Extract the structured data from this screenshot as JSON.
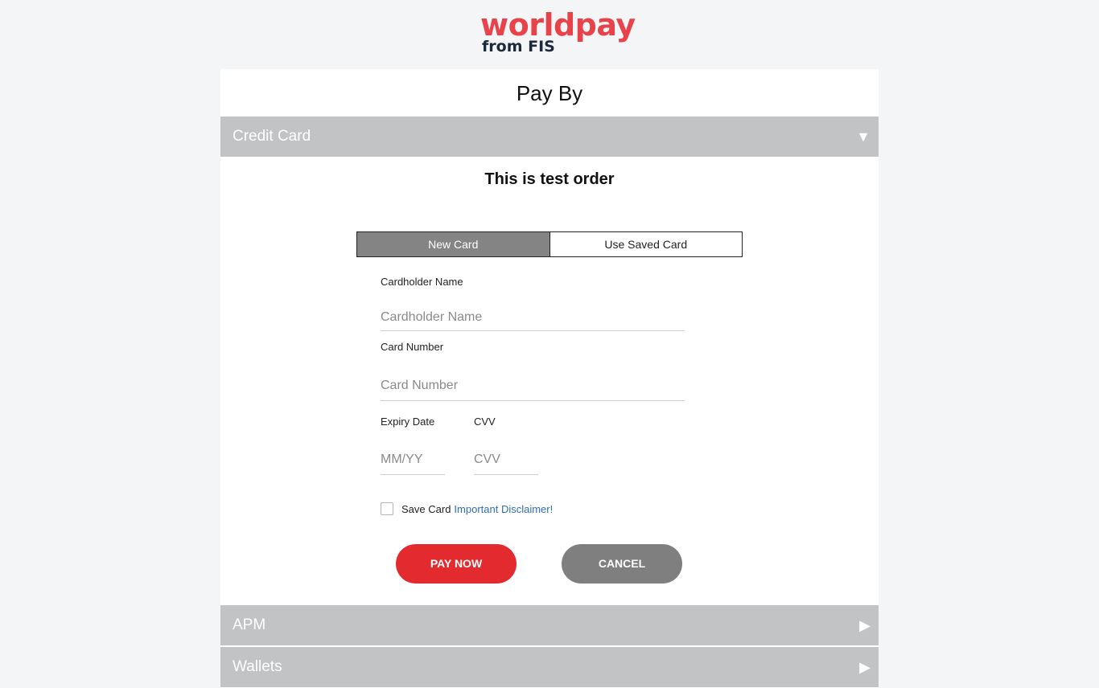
{
  "brand": {
    "logo_main": "worldpay",
    "logo_sub": "from FIS",
    "logo_color": "#e8434a",
    "logo_sub_color": "#1b2a3a"
  },
  "page": {
    "title": "Pay By",
    "order_title": "This is test order"
  },
  "accordion": {
    "credit_card": "Credit Card",
    "apm": "APM",
    "wallets": "Wallets",
    "expanded_icon": "caret-down-icon",
    "collapsed_icon": "caret-right-icon"
  },
  "tabs": {
    "new_card": "New Card",
    "saved_card": "Use Saved Card"
  },
  "form": {
    "cardholder_label": "Cardholder Name",
    "cardholder_placeholder": "Cardholder Name",
    "card_number_label": "Card Number",
    "card_number_placeholder": "Card Number",
    "expiry_label": "Expiry Date",
    "expiry_placeholder": "MM/YY",
    "cvv_label": "CVV",
    "cvv_placeholder": "CVV",
    "save_card_label": "Save Card",
    "disclaimer_link": "Important Disclaimer!"
  },
  "buttons": {
    "pay_now": "PAY NOW",
    "cancel": "CANCEL"
  },
  "colors": {
    "pay_button": "#e32b2f",
    "cancel_button": "#7f7f7f",
    "accordion_header": "#c2c3c5",
    "active_tab": "#848484",
    "link": "#2f6fb3"
  }
}
